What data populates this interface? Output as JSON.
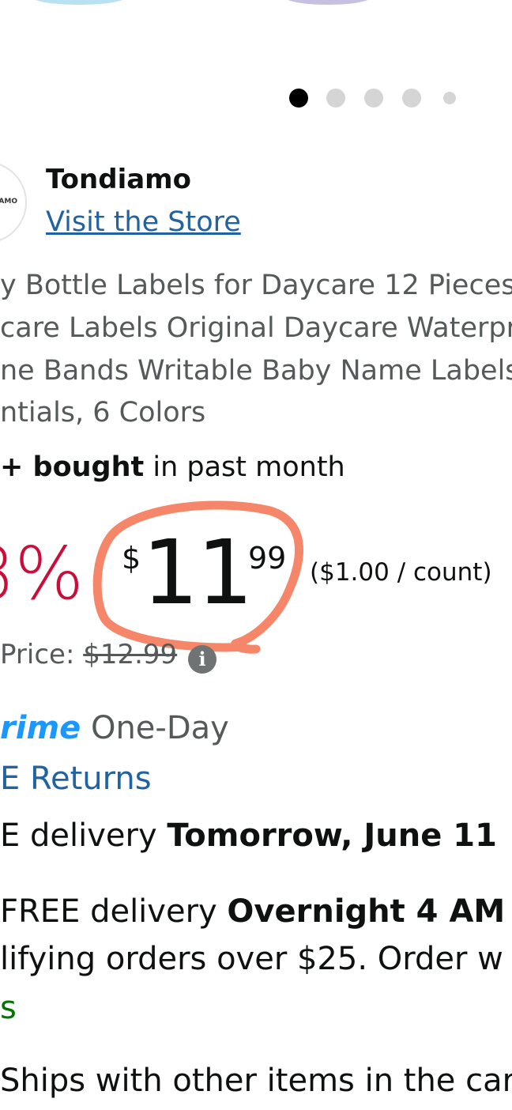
{
  "carousel": {
    "dot_count": 5,
    "active_index": 0
  },
  "brand": {
    "logo_text": "AMO",
    "name": "Tondiamo",
    "visit_store": "Visit the Store"
  },
  "product": {
    "title_lines": [
      "y Bottle Labels for Daycare 12 Pieces",
      "care Labels Original Daycare Waterpro",
      "ne Bands Writable Baby Name Labels",
      "ntials, 6 Colors"
    ],
    "bought_prefix": "+ bought",
    "bought_suffix": " in past month"
  },
  "price": {
    "discount": "8%",
    "currency_symbol": "$",
    "whole": "11",
    "fraction": "99",
    "per_unit": "($1.00 / count)",
    "list_price_label": "Price: ",
    "list_price_value": "$12.99",
    "info_icon": "i",
    "annotation_color": "#f4714f"
  },
  "shipping": {
    "prime_word": "rime",
    "prime_suffix": " One-Day",
    "returns": "E Returns",
    "delivery_prefix": "E delivery ",
    "delivery_date": "Tomorrow, June 11",
    "fastest_prefix": "FREE delivery ",
    "fastest_time": "Overnight 4 AM -",
    "qualifying_text": "lifying orders over $25. Order w",
    "details_link": "s",
    "ships_with": "Ships with other items in the car"
  },
  "colors": {
    "discount_red": "#cc0c39",
    "link_blue": "#2162a1",
    "prime_blue": "#1a98ff",
    "secondary_gray": "#565959",
    "green": "#007600"
  }
}
